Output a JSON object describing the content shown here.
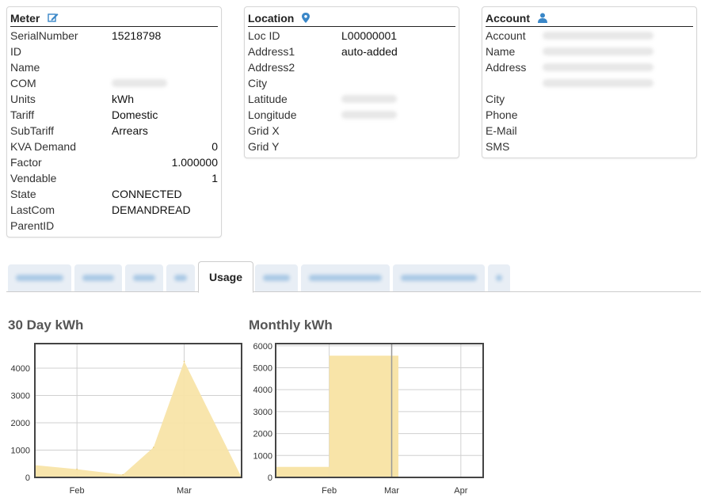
{
  "meter": {
    "title": "Meter",
    "rows": [
      {
        "label": "SerialNumber",
        "value": "15218798"
      },
      {
        "label": "ID",
        "value": ""
      },
      {
        "label": "Name",
        "value": ""
      },
      {
        "label": "COM",
        "value": "",
        "blurred": true
      },
      {
        "label": "Units",
        "value": "kWh"
      },
      {
        "label": "Tariff",
        "value": "Domestic"
      },
      {
        "label": "SubTariff",
        "value": "Arrears"
      },
      {
        "label": "KVA Demand",
        "value": "0",
        "align": "right"
      },
      {
        "label": "Factor",
        "value": "1.000000",
        "align": "right"
      },
      {
        "label": "Vendable",
        "value": "1",
        "align": "right"
      },
      {
        "label": "State",
        "value": "CONNECTED"
      },
      {
        "label": "LastCom",
        "value": "DEMANDREAD"
      },
      {
        "label": "ParentID",
        "value": ""
      }
    ]
  },
  "location": {
    "title": "Location",
    "rows": [
      {
        "label": "Loc ID",
        "value": "L00000001"
      },
      {
        "label": "Address1",
        "value": "auto-added"
      },
      {
        "label": "Address2",
        "value": ""
      },
      {
        "label": "City",
        "value": ""
      },
      {
        "label": "Latitude",
        "value": "",
        "blurred": true
      },
      {
        "label": "Longitude",
        "value": "",
        "blurred": true
      },
      {
        "label": "Grid X",
        "value": ""
      },
      {
        "label": "Grid Y",
        "value": ""
      }
    ]
  },
  "account": {
    "title": "Account",
    "rows": [
      {
        "label": "Account",
        "value": "",
        "blurred": true
      },
      {
        "label": "Name",
        "value": "",
        "blurred": true
      },
      {
        "label": "Address",
        "value": "",
        "blurred": true
      },
      {
        "label": "",
        "value": "",
        "blurred": true
      },
      {
        "label": "City",
        "value": ""
      },
      {
        "label": "Phone",
        "value": ""
      },
      {
        "label": "E-Mail",
        "value": ""
      },
      {
        "label": "SMS",
        "value": ""
      }
    ]
  },
  "tabs": [
    {
      "label": "",
      "blurred": true
    },
    {
      "label": "",
      "blurred": true
    },
    {
      "label": "",
      "blurred": true
    },
    {
      "label": "",
      "blurred": true
    },
    {
      "label": "Usage",
      "active": true
    },
    {
      "label": "",
      "blurred": true
    },
    {
      "label": "",
      "blurred": true
    },
    {
      "label": "",
      "blurred": true
    },
    {
      "label": "",
      "blurred": true
    }
  ],
  "colors": {
    "accent": "#3a87c8",
    "fill": "#f8e4a8",
    "grid": "#d0d0d0"
  },
  "chart_data": [
    {
      "type": "area",
      "title": "30 Day kWh",
      "x_ticks": [
        "Feb",
        "Mar"
      ],
      "y_ticks": [
        0,
        1000,
        2000,
        3000,
        4000
      ],
      "ylim": [
        0,
        4900
      ],
      "points": [
        {
          "x": "Jan 21",
          "y": 450
        },
        {
          "x": "Feb 1",
          "y": 300
        },
        {
          "x": "Feb 13",
          "y": 100
        },
        {
          "x": "Feb 21",
          "y": 1100
        },
        {
          "x": "Mar 1",
          "y": 4250
        },
        {
          "x": "Mar 16",
          "y": 0
        }
      ]
    },
    {
      "type": "bar",
      "title": "Monthly kWh",
      "x_ticks": [
        "Feb",
        "Mar",
        "Apr"
      ],
      "y_ticks": [
        0,
        1000,
        2000,
        3000,
        4000,
        5000,
        6000
      ],
      "ylim": [
        0,
        6100
      ],
      "categories": [
        "Jan",
        "Feb"
      ],
      "values": [
        480,
        5550
      ]
    }
  ]
}
